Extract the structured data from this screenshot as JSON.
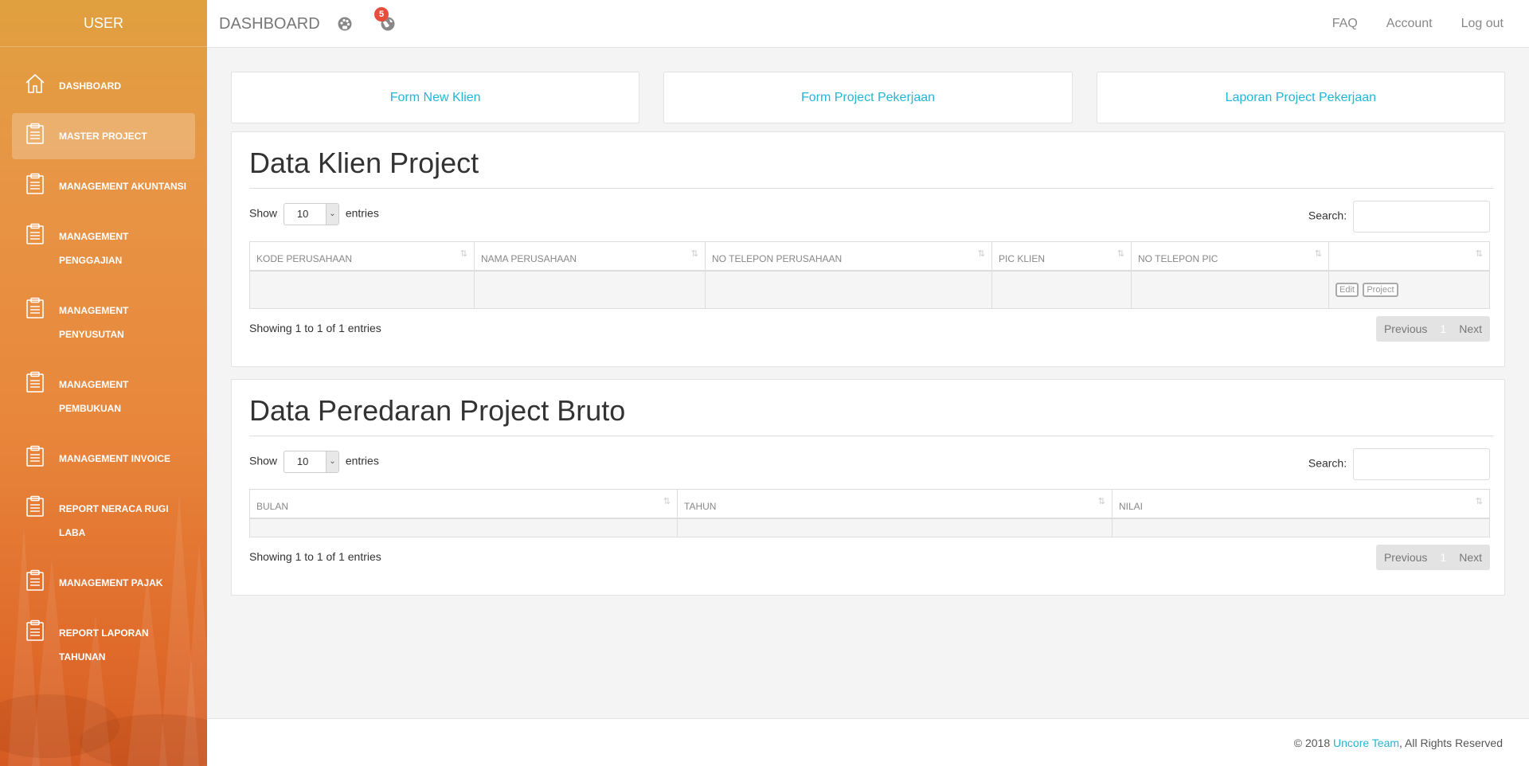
{
  "colors": {
    "accent": "#23b6d6",
    "sidebar_top": "#e0a040",
    "sidebar_bottom": "#d45a22",
    "badge": "#e74c3c"
  },
  "sidebar": {
    "brand": "USER",
    "items": [
      {
        "label": "DASHBOARD",
        "icon": "home-icon",
        "active": false
      },
      {
        "label": "MASTER PROJECT",
        "icon": "clipboard-icon",
        "active": true
      },
      {
        "label": "MANAGEMENT AKUNTANSI",
        "icon": "clipboard-icon",
        "active": false
      },
      {
        "label": "MANAGEMENT PENGGAJIAN",
        "icon": "clipboard-icon",
        "active": false
      },
      {
        "label": "MANAGEMENT PENYUSUTAN",
        "icon": "clipboard-icon",
        "active": false
      },
      {
        "label": "MANAGEMENT PEMBUKUAN",
        "icon": "clipboard-icon",
        "active": false
      },
      {
        "label": "MANAGEMENT INVOICE",
        "icon": "clipboard-icon",
        "active": false
      },
      {
        "label": "REPORT NERACA RUGI LABA",
        "icon": "clipboard-icon",
        "active": false
      },
      {
        "label": "MANAGEMENT PAJAK",
        "icon": "clipboard-icon",
        "active": false
      },
      {
        "label": "REPORT LAPORAN TAHUNAN",
        "icon": "clipboard-icon",
        "active": false
      }
    ]
  },
  "topbar": {
    "brand": "DASHBOARD",
    "icons": [
      "palette-icon",
      "globe-icon"
    ],
    "notification_count": "5",
    "links": [
      "FAQ",
      "Account",
      "Log out"
    ]
  },
  "cards": [
    "Form New Klien",
    "Form Project Pekerjaan",
    "Laporan Project Pekerjaan"
  ],
  "klien_table": {
    "title": "Data Klien Project",
    "show_label": "Show",
    "entries_value": "10",
    "entries_label": "entries",
    "search_label": "Search:",
    "columns": [
      "KODE PERUSAHAAN",
      "NAMA PERUSAHAAN",
      "NO TELEPON PERUSAHAAN",
      "PIC KLIEN",
      "NO TELEPON PIC",
      ""
    ],
    "row_buttons": [
      "Edit",
      "Project"
    ],
    "info": "Showing 1 to 1 of 1 entries",
    "pager": {
      "prev": "Previous",
      "page": "1",
      "next": "Next"
    }
  },
  "bruto_table": {
    "title": "Data Peredaran Project Bruto",
    "show_label": "Show",
    "entries_value": "10",
    "entries_label": "entries",
    "search_label": "Search:",
    "columns": [
      "BULAN",
      "TAHUN",
      "NILAI"
    ],
    "info": "Showing 1 to 1 of 1 entries",
    "pager": {
      "prev": "Previous",
      "page": "1",
      "next": "Next"
    }
  },
  "footer": {
    "prefix": "© 2018 ",
    "team": "Uncore Team",
    "suffix": ", All Rights Reserved"
  }
}
